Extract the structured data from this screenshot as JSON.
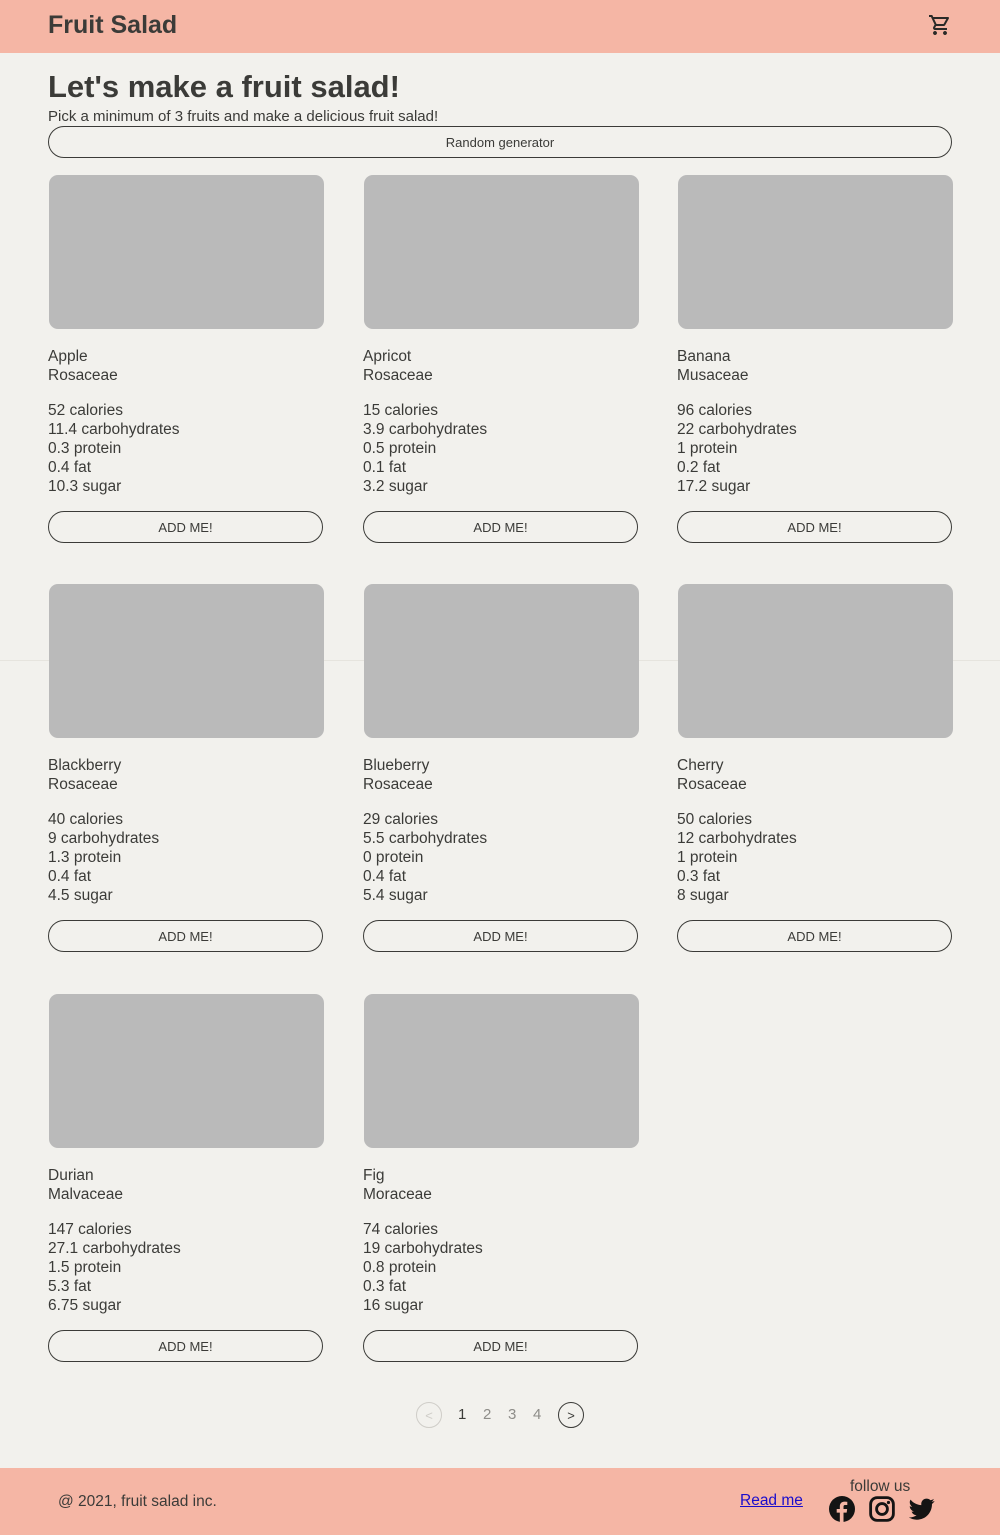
{
  "header": {
    "brand": "Fruit Salad",
    "cart_icon": "shopping-cart-icon"
  },
  "hero": {
    "title": "Let's make a fruit salad!",
    "subtitle": "Pick a minimum of 3 fruits and make a delicious fruit salad!",
    "random_label": "Random generator"
  },
  "add_label": "ADD ME!",
  "fruits": [
    {
      "name": "Apple",
      "family": "Rosaceae",
      "calories": "52 calories",
      "carbs": "11.4 carbohydrates",
      "protein": "0.3 protein",
      "fat": "0.4 fat",
      "sugar": "10.3 sugar"
    },
    {
      "name": "Apricot",
      "family": "Rosaceae",
      "calories": "15 calories",
      "carbs": "3.9 carbohydrates",
      "protein": "0.5 protein",
      "fat": "0.1 fat",
      "sugar": "3.2 sugar"
    },
    {
      "name": "Banana",
      "family": "Musaceae",
      "calories": "96 calories",
      "carbs": "22 carbohydrates",
      "protein": "1 protein",
      "fat": "0.2 fat",
      "sugar": "17.2 sugar"
    },
    {
      "name": "Blackberry",
      "family": "Rosaceae",
      "calories": "40 calories",
      "carbs": "9 carbohydrates",
      "protein": "1.3 protein",
      "fat": "0.4 fat",
      "sugar": "4.5 sugar"
    },
    {
      "name": "Blueberry",
      "family": "Rosaceae",
      "calories": "29 calories",
      "carbs": "5.5 carbohydrates",
      "protein": "0 protein",
      "fat": "0.4 fat",
      "sugar": "5.4 sugar"
    },
    {
      "name": "Cherry",
      "family": "Rosaceae",
      "calories": "50 calories",
      "carbs": "12 carbohydrates",
      "protein": "1 protein",
      "fat": "0.3 fat",
      "sugar": "8 sugar"
    },
    {
      "name": "Durian",
      "family": "Malvaceae",
      "calories": "147 calories",
      "carbs": "27.1 carbohydrates",
      "protein": "1.5 protein",
      "fat": "5.3 fat",
      "sugar": "6.75 sugar"
    },
    {
      "name": "Fig",
      "family": "Moraceae",
      "calories": "74 calories",
      "carbs": "19 carbohydrates",
      "protein": "0.8 protein",
      "fat": "0.3 fat",
      "sugar": "16 sugar"
    }
  ],
  "pagination": {
    "prev": "<",
    "next": ">",
    "pages": [
      "1",
      "2",
      "3",
      "4"
    ],
    "current": "1"
  },
  "footer": {
    "copyright": "@ 2021, fruit salad inc.",
    "readme": "Read me",
    "follow": "follow us",
    "social_icons": [
      "facebook-icon",
      "instagram-icon",
      "twitter-icon"
    ]
  },
  "colors": {
    "header_bg": "#f5b6a5",
    "page_bg": "#f2f1ed",
    "text": "#3b3b38",
    "placeholder": "#bababa",
    "link": "#1a0dcc"
  }
}
